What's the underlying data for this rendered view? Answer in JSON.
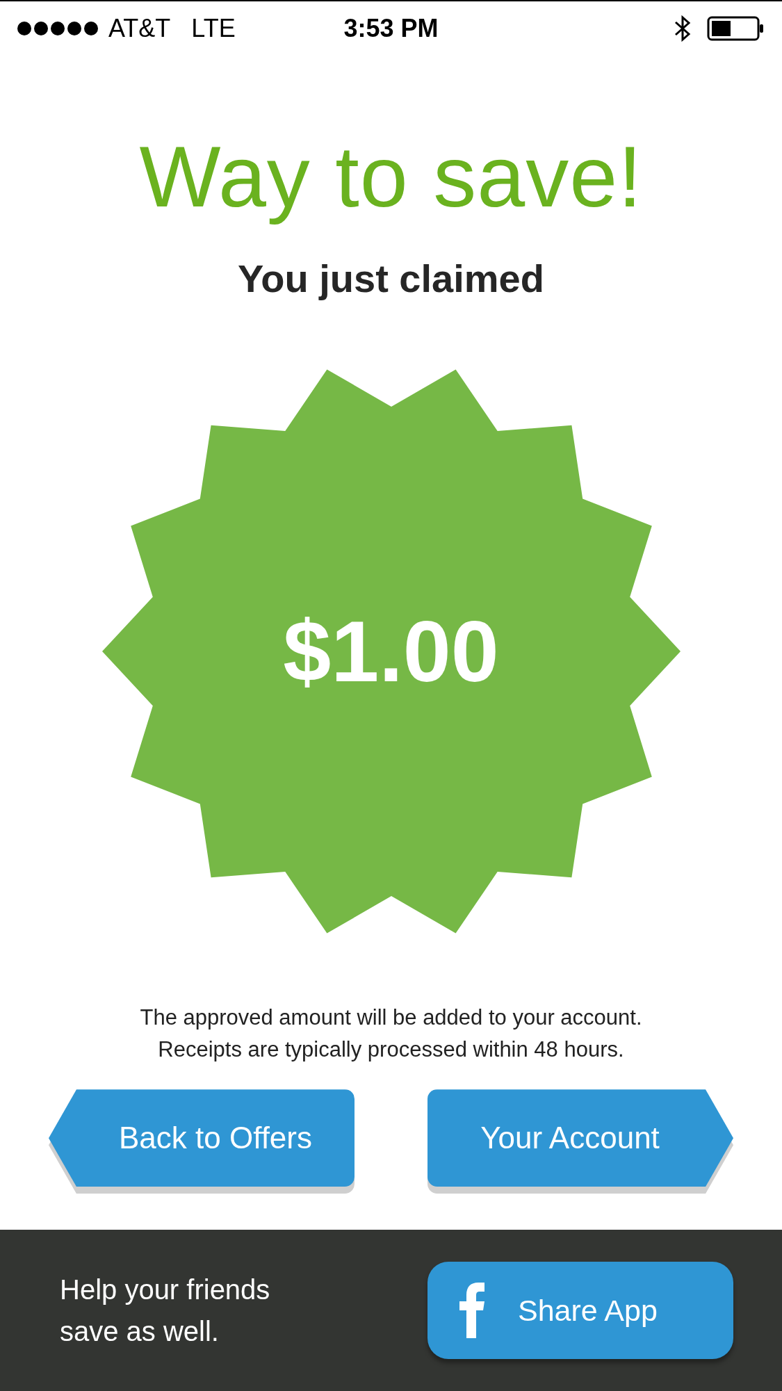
{
  "status_bar": {
    "carrier": "AT&T",
    "network": "LTE",
    "time": "3:53 PM"
  },
  "heading": "Way to save!",
  "subheading": "You just claimed",
  "badge": {
    "amount": "$1.00"
  },
  "note_lines": [
    "The approved amount will be added to your account.",
    "Receipts are typically processed within 48 hours."
  ],
  "buttons": [
    {
      "label": "Back to Offers",
      "kind": "back"
    },
    {
      "label": "Your Account",
      "kind": "forward"
    }
  ],
  "footer": {
    "message_lines": [
      "Help your friends",
      "save as well."
    ],
    "share_button": {
      "label": "Share App"
    }
  }
}
